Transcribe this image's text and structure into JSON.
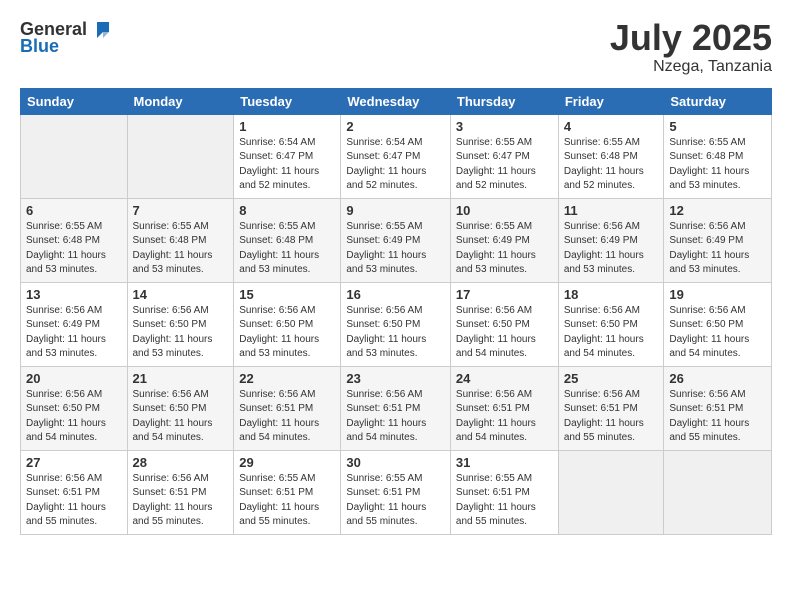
{
  "header": {
    "logo_general": "General",
    "logo_blue": "Blue",
    "month": "July 2025",
    "location": "Nzega, Tanzania"
  },
  "columns": [
    "Sunday",
    "Monday",
    "Tuesday",
    "Wednesday",
    "Thursday",
    "Friday",
    "Saturday"
  ],
  "weeks": [
    [
      {
        "day": "",
        "info": ""
      },
      {
        "day": "",
        "info": ""
      },
      {
        "day": "1",
        "info": "Sunrise: 6:54 AM\nSunset: 6:47 PM\nDaylight: 11 hours and 52 minutes."
      },
      {
        "day": "2",
        "info": "Sunrise: 6:54 AM\nSunset: 6:47 PM\nDaylight: 11 hours and 52 minutes."
      },
      {
        "day": "3",
        "info": "Sunrise: 6:55 AM\nSunset: 6:47 PM\nDaylight: 11 hours and 52 minutes."
      },
      {
        "day": "4",
        "info": "Sunrise: 6:55 AM\nSunset: 6:48 PM\nDaylight: 11 hours and 52 minutes."
      },
      {
        "day": "5",
        "info": "Sunrise: 6:55 AM\nSunset: 6:48 PM\nDaylight: 11 hours and 53 minutes."
      }
    ],
    [
      {
        "day": "6",
        "info": "Sunrise: 6:55 AM\nSunset: 6:48 PM\nDaylight: 11 hours and 53 minutes."
      },
      {
        "day": "7",
        "info": "Sunrise: 6:55 AM\nSunset: 6:48 PM\nDaylight: 11 hours and 53 minutes."
      },
      {
        "day": "8",
        "info": "Sunrise: 6:55 AM\nSunset: 6:48 PM\nDaylight: 11 hours and 53 minutes."
      },
      {
        "day": "9",
        "info": "Sunrise: 6:55 AM\nSunset: 6:49 PM\nDaylight: 11 hours and 53 minutes."
      },
      {
        "day": "10",
        "info": "Sunrise: 6:55 AM\nSunset: 6:49 PM\nDaylight: 11 hours and 53 minutes."
      },
      {
        "day": "11",
        "info": "Sunrise: 6:56 AM\nSunset: 6:49 PM\nDaylight: 11 hours and 53 minutes."
      },
      {
        "day": "12",
        "info": "Sunrise: 6:56 AM\nSunset: 6:49 PM\nDaylight: 11 hours and 53 minutes."
      }
    ],
    [
      {
        "day": "13",
        "info": "Sunrise: 6:56 AM\nSunset: 6:49 PM\nDaylight: 11 hours and 53 minutes."
      },
      {
        "day": "14",
        "info": "Sunrise: 6:56 AM\nSunset: 6:50 PM\nDaylight: 11 hours and 53 minutes."
      },
      {
        "day": "15",
        "info": "Sunrise: 6:56 AM\nSunset: 6:50 PM\nDaylight: 11 hours and 53 minutes."
      },
      {
        "day": "16",
        "info": "Sunrise: 6:56 AM\nSunset: 6:50 PM\nDaylight: 11 hours and 53 minutes."
      },
      {
        "day": "17",
        "info": "Sunrise: 6:56 AM\nSunset: 6:50 PM\nDaylight: 11 hours and 54 minutes."
      },
      {
        "day": "18",
        "info": "Sunrise: 6:56 AM\nSunset: 6:50 PM\nDaylight: 11 hours and 54 minutes."
      },
      {
        "day": "19",
        "info": "Sunrise: 6:56 AM\nSunset: 6:50 PM\nDaylight: 11 hours and 54 minutes."
      }
    ],
    [
      {
        "day": "20",
        "info": "Sunrise: 6:56 AM\nSunset: 6:50 PM\nDaylight: 11 hours and 54 minutes."
      },
      {
        "day": "21",
        "info": "Sunrise: 6:56 AM\nSunset: 6:50 PM\nDaylight: 11 hours and 54 minutes."
      },
      {
        "day": "22",
        "info": "Sunrise: 6:56 AM\nSunset: 6:51 PM\nDaylight: 11 hours and 54 minutes."
      },
      {
        "day": "23",
        "info": "Sunrise: 6:56 AM\nSunset: 6:51 PM\nDaylight: 11 hours and 54 minutes."
      },
      {
        "day": "24",
        "info": "Sunrise: 6:56 AM\nSunset: 6:51 PM\nDaylight: 11 hours and 54 minutes."
      },
      {
        "day": "25",
        "info": "Sunrise: 6:56 AM\nSunset: 6:51 PM\nDaylight: 11 hours and 55 minutes."
      },
      {
        "day": "26",
        "info": "Sunrise: 6:56 AM\nSunset: 6:51 PM\nDaylight: 11 hours and 55 minutes."
      }
    ],
    [
      {
        "day": "27",
        "info": "Sunrise: 6:56 AM\nSunset: 6:51 PM\nDaylight: 11 hours and 55 minutes."
      },
      {
        "day": "28",
        "info": "Sunrise: 6:56 AM\nSunset: 6:51 PM\nDaylight: 11 hours and 55 minutes."
      },
      {
        "day": "29",
        "info": "Sunrise: 6:55 AM\nSunset: 6:51 PM\nDaylight: 11 hours and 55 minutes."
      },
      {
        "day": "30",
        "info": "Sunrise: 6:55 AM\nSunset: 6:51 PM\nDaylight: 11 hours and 55 minutes."
      },
      {
        "day": "31",
        "info": "Sunrise: 6:55 AM\nSunset: 6:51 PM\nDaylight: 11 hours and 55 minutes."
      },
      {
        "day": "",
        "info": ""
      },
      {
        "day": "",
        "info": ""
      }
    ]
  ]
}
